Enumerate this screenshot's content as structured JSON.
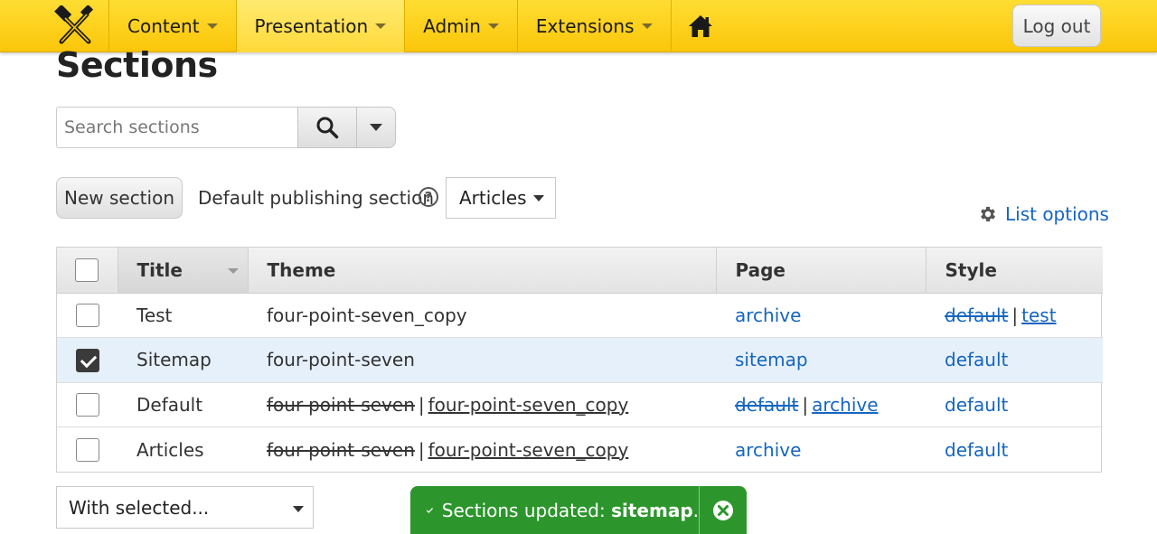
{
  "nav": {
    "items": [
      {
        "label": "Content",
        "active": false
      },
      {
        "label": "Presentation",
        "active": true
      },
      {
        "label": "Admin",
        "active": false
      },
      {
        "label": "Extensions",
        "active": false
      }
    ],
    "home_icon": "home-icon",
    "logout_label": "Log out"
  },
  "page": {
    "title": "Sections"
  },
  "search": {
    "placeholder": "Search sections",
    "value": "",
    "icon": "search-icon"
  },
  "controls": {
    "new_section_label": "New section",
    "default_publishing_label": "Default publishing section",
    "default_publishing_value": "Articles",
    "list_options_label": "List options"
  },
  "table": {
    "headers": {
      "title": "Title",
      "theme": "Theme",
      "page": "Page",
      "style": "Style"
    },
    "rows": [
      {
        "title": "Test",
        "checked": false,
        "theme_old": "",
        "theme": "four-point-seven_copy",
        "page_old": "",
        "page": "archive",
        "style_old": "default",
        "style": "test"
      },
      {
        "title": "Sitemap",
        "checked": true,
        "theme_old": "",
        "theme": "four-point-seven",
        "page_old": "",
        "page": "sitemap",
        "style_old": "",
        "style": "default"
      },
      {
        "title": "Default",
        "checked": false,
        "theme_old": "four-point-seven",
        "theme": "four-point-seven_copy",
        "page_old": "default",
        "page": "archive",
        "style_old": "",
        "style": "default"
      },
      {
        "title": "Articles",
        "checked": false,
        "theme_old": "four-point-seven",
        "theme": "four-point-seven_copy",
        "page_old": "",
        "page": "archive",
        "style_old": "",
        "style": "default"
      }
    ],
    "separator": "|"
  },
  "bulk": {
    "label": "With selected..."
  },
  "toast": {
    "prefix": "Sections updated: ",
    "name": "sitemap",
    "suffix": ".",
    "bg": "#2c962c"
  },
  "colors": {
    "topbar": "#fbc60a",
    "link": "#1565c0",
    "selected_row": "#e6f0fb"
  }
}
